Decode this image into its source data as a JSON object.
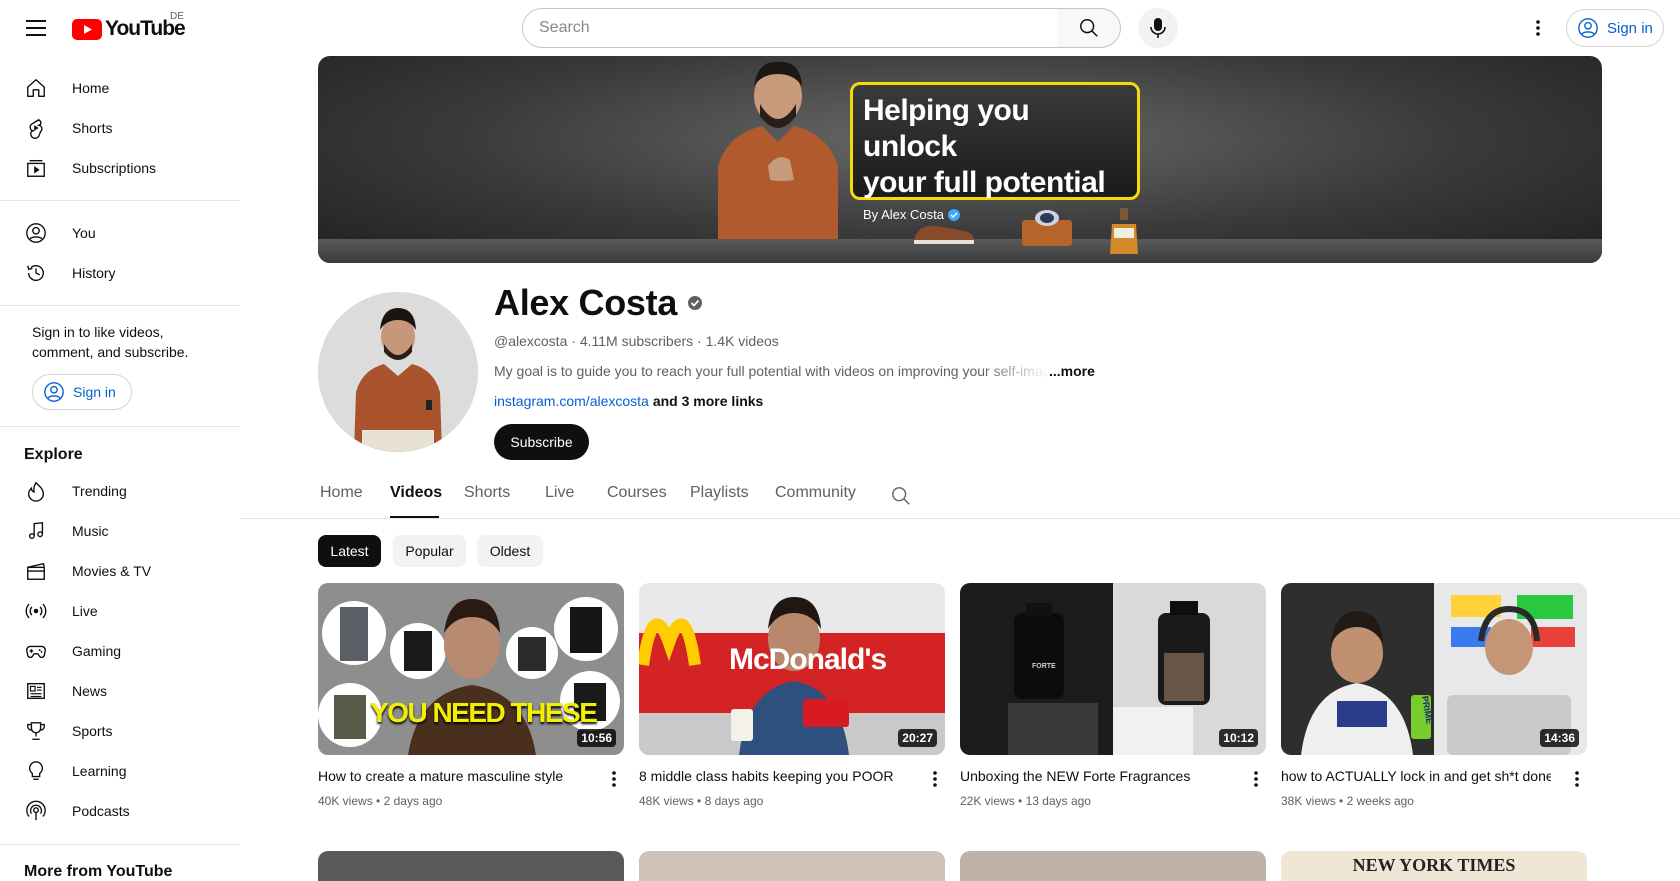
{
  "header": {
    "logo_text": "YouTube",
    "region": "DE",
    "search_placeholder": "Search",
    "sign_in": "Sign in"
  },
  "sidebar": {
    "primary": [
      {
        "label": "Home",
        "icon": "home-icon"
      },
      {
        "label": "Shorts",
        "icon": "shorts-icon"
      },
      {
        "label": "Subscriptions",
        "icon": "subscriptions-icon"
      }
    ],
    "you": [
      {
        "label": "You",
        "icon": "account-icon"
      },
      {
        "label": "History",
        "icon": "history-icon"
      }
    ],
    "signin_prompt": "Sign in to like videos, comment, and subscribe.",
    "signin_button": "Sign in",
    "explore_heading": "Explore",
    "explore": [
      {
        "label": "Trending",
        "icon": "trending-icon"
      },
      {
        "label": "Music",
        "icon": "music-icon"
      },
      {
        "label": "Movies & TV",
        "icon": "movies-icon"
      },
      {
        "label": "Live",
        "icon": "live-icon"
      },
      {
        "label": "Gaming",
        "icon": "gaming-icon"
      },
      {
        "label": "News",
        "icon": "news-icon"
      },
      {
        "label": "Sports",
        "icon": "sports-icon"
      },
      {
        "label": "Learning",
        "icon": "learning-icon"
      },
      {
        "label": "Podcasts",
        "icon": "podcasts-icon"
      }
    ],
    "more_heading": "More from YouTube"
  },
  "banner": {
    "headline_line1": "Helping you unlock",
    "headline_line2": "your full potential",
    "byline": "By Alex Costa"
  },
  "channel": {
    "name": "Alex Costa",
    "handle": "@alexcosta",
    "subscribers": "4.11M subscribers",
    "videos": "1.4K videos",
    "description": "My goal is to guide you to reach your full potential with videos on improving your self-image",
    "more": "...more",
    "link": "instagram.com/alexcosta",
    "more_links": "and 3 more links",
    "subscribe": "Subscribe"
  },
  "tabs": [
    {
      "label": "Home",
      "active": false
    },
    {
      "label": "Videos",
      "active": true
    },
    {
      "label": "Shorts",
      "active": false
    },
    {
      "label": "Live",
      "active": false
    },
    {
      "label": "Courses",
      "active": false
    },
    {
      "label": "Playlists",
      "active": false
    },
    {
      "label": "Community",
      "active": false
    }
  ],
  "chips": [
    {
      "label": "Latest",
      "active": true
    },
    {
      "label": "Popular",
      "active": false
    },
    {
      "label": "Oldest",
      "active": false
    }
  ],
  "videos": [
    {
      "title": "How to create a mature masculine style",
      "views": "40K views",
      "age": "2 days ago",
      "duration": "10:56",
      "thumb_text": "YOU NEED THESE"
    },
    {
      "title": "8 middle class habits keeping you POOR",
      "views": "48K views",
      "age": "8 days ago",
      "duration": "20:27",
      "thumb_text": "McDonald's"
    },
    {
      "title": "Unboxing the NEW Forte Fragrances",
      "views": "22K views",
      "age": "13 days ago",
      "duration": "10:12",
      "thumb_text": "FORTE"
    },
    {
      "title": "how to ACTUALLY lock in and get sh*t done.",
      "views": "38K views",
      "age": "2 weeks ago",
      "duration": "14:36",
      "thumb_text": "PRIME"
    }
  ],
  "next_row": {
    "thumb4_text": "NEW YORK TIMES"
  },
  "colors": {
    "brand_red": "#ff0000",
    "link_blue": "#065fd4",
    "banner_accent": "#f5d90a"
  }
}
